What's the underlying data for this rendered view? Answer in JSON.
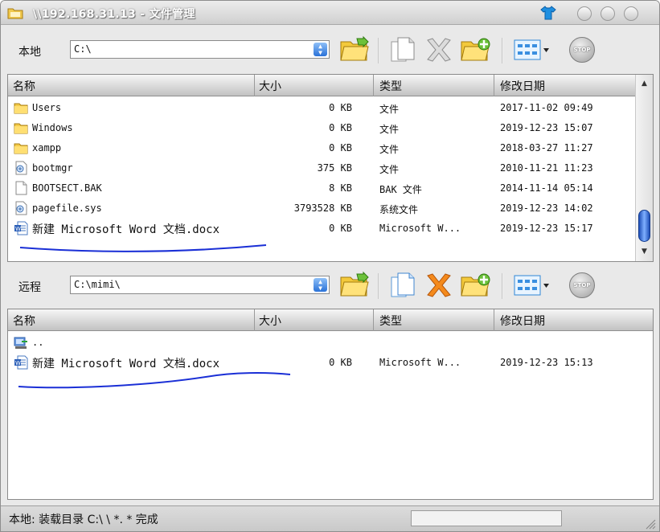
{
  "window": {
    "title": "\\\\192.168.31.13 - 文件管理"
  },
  "local": {
    "label": "本地",
    "path": "C:\\",
    "columns": {
      "name": "名称",
      "size": "大小",
      "type": "类型",
      "date": "修改日期"
    },
    "files": [
      {
        "icon": "folder-icon",
        "name": "Users",
        "size": "0 KB",
        "type": "文件",
        "date": "2017-11-02 09:49"
      },
      {
        "icon": "folder-icon",
        "name": "Windows",
        "size": "0 KB",
        "type": "文件",
        "date": "2019-12-23 15:07"
      },
      {
        "icon": "folder-icon",
        "name": "xampp",
        "size": "0 KB",
        "type": "文件",
        "date": "2018-03-27 11:27"
      },
      {
        "icon": "system-file-icon",
        "name": "bootmgr",
        "size": "375 KB",
        "type": "文件",
        "date": "2010-11-21 11:23"
      },
      {
        "icon": "blank-file-icon",
        "name": "BOOTSECT.BAK",
        "size": "8 KB",
        "type": "BAK 文件",
        "date": "2014-11-14 05:14"
      },
      {
        "icon": "system-file-icon",
        "name": "pagefile.sys",
        "size": "3793528 KB",
        "type": "系统文件",
        "date": "2019-12-23 14:02"
      },
      {
        "icon": "word-doc-icon",
        "name": "新建 Microsoft Word 文档.docx",
        "size": "0 KB",
        "type": "Microsoft W...",
        "date": "2019-12-23 15:17"
      }
    ]
  },
  "remote": {
    "label": "远程",
    "path": "C:\\mimi\\",
    "columns": {
      "name": "名称",
      "size": "大小",
      "type": "类型",
      "date": "修改日期"
    },
    "files": [
      {
        "icon": "parent-dir-icon",
        "name": "..",
        "size": "",
        "type": "",
        "date": ""
      },
      {
        "icon": "word-doc-icon",
        "name": "新建 Microsoft Word 文档.docx",
        "size": "0 KB",
        "type": "Microsoft W...",
        "date": "2019-12-23 15:13"
      }
    ]
  },
  "toolbar_icons": [
    "folder-up-icon",
    "copy-icon",
    "delete-icon",
    "new-folder-icon",
    "view-mode-icon",
    "stop-icon"
  ],
  "toolbar": {
    "stop_label": "STOP"
  },
  "status": {
    "text": "本地: 装载目录 C:\\ \\ *. * 完成"
  },
  "colors": {
    "accent": "#1e4fb8",
    "annotation_stroke": "#1a2fd6"
  }
}
